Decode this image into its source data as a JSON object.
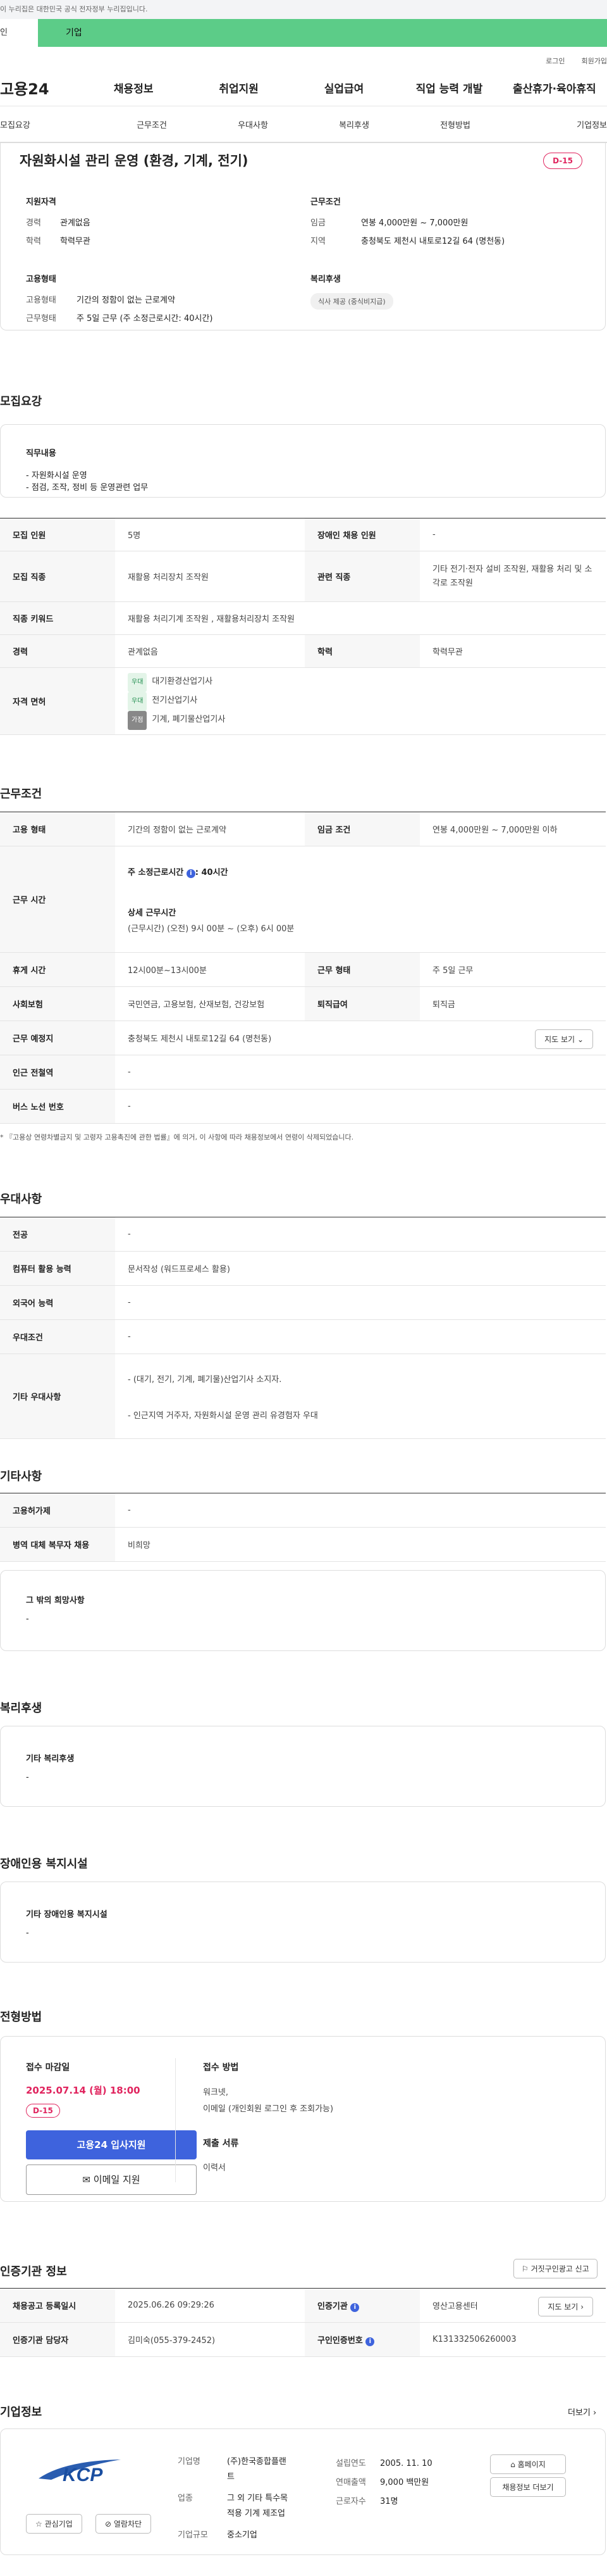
{
  "topbar": {
    "gov_notice": "이 누리집은 대한민국 공식 전자정부 누리집입니다."
  },
  "tabs": {
    "tab1": "인",
    "tab2": "기업"
  },
  "util": {
    "login": "로그인",
    "join": "회원가입"
  },
  "gnb": {
    "logo": "고용24",
    "menu": [
      "채용정보",
      "취업지원",
      "실업급여",
      "직업 능력 개발",
      "출산휴가·육아휴직"
    ]
  },
  "subnav": [
    "모집요강",
    "근무조건",
    "우대사항",
    "복리후생",
    "전형방법",
    "기업정보"
  ],
  "job": {
    "title": "자원화시설 관리 운영 (환경, 기계, 전기)",
    "dday": "D-15",
    "qual_title": "지원자격",
    "career_k": "경력",
    "career_v": "관계없음",
    "edu_k": "학력",
    "edu_v": "학력무관",
    "cond_title": "근무조건",
    "wage_k": "임금",
    "wage_v": "연봉 4,000만원 ~ 7,000만원",
    "loc_k": "지역",
    "loc_v": "충청북도 제천시 내토로12길 64 (명천동)",
    "emp_title": "고용형태",
    "emptype_k": "고용형태",
    "emptype_v": "기간의 정함이 없는 근로계약",
    "worktype_k": "근무형태",
    "worktype_v": "주 5일 근무 (주 소정근로시간: 40시간)",
    "welfare_title": "복리후생",
    "welfare_chip": "식사 제공 (중식비지급)"
  },
  "recruit": {
    "title": "모집요강",
    "duty_title": "직무내용",
    "duty_lines": [
      "- 자원화시설 운영",
      "- 점검, 조작, 정비 등 운영관련 업무"
    ],
    "rows": {
      "count_k": "모집 인원",
      "count_v": "5명",
      "disabled_k": "장애인 채용 인원",
      "disabled_v": "-",
      "job_k": "모집 직종",
      "job_v": "재활용 처리장치 조작원",
      "rel_k": "관련 직종",
      "rel_v": "기타 전기·전자 설비 조작원, 재활용 처리 및 소각로 조작원",
      "kw_k": "직종 키워드",
      "kw_v": "재활용 처리기계 조작원 , 재활용처리장치 조작원",
      "career_k": "경력",
      "career_v": "관계없음",
      "edu_k": "학력",
      "edu_v": "학력무관",
      "lic_k": "자격 면허",
      "lic": [
        {
          "tag": "우대",
          "name": "대기환경산업기사"
        },
        {
          "tag": "우대",
          "name": "전기산업기사"
        },
        {
          "tag": "가점",
          "name": "기계, 폐기물산업기사"
        }
      ]
    }
  },
  "work": {
    "title": "근무조건",
    "emp_k": "고용 형태",
    "emp_v": "기간의 정함이 없는 근로계약",
    "wage_k": "임금 조건",
    "wage_v": "연봉 4,000만원 ~ 7,000만원 이하",
    "time_k": "근무 시간",
    "time_week": "주 소정근로시간",
    "time_week_v": ": 40시간",
    "time_detail_t": "상세 근무시간",
    "time_detail_v": "(근무시간) (오전) 9시 00분 ~ (오후) 6시 00분",
    "rest_k": "휴게 시간",
    "rest_v": "12시00분~13시00분",
    "form_k": "근무 형태",
    "form_v": "주 5일 근무",
    "ins_k": "사회보험",
    "ins_v": "국민연금, 고용보험, 산재보험, 건강보험",
    "sev_k": "퇴직급여",
    "sev_v": "퇴직금",
    "place_k": "근무 예정지",
    "place_v": "충청북도 제천시 내토로12길 64 (명천동)",
    "map_btn": "지도 보기",
    "subway_k": "인근 전철역",
    "subway_v": "-",
    "bus_k": "버스 노선 번호",
    "bus_v": "-",
    "note": "『고용상 연령차별금지 및 고령자 고용촉진에 관한 법률』에 의거, 이 사항에 따라 채용정보에서 연령이 삭제되었습니다."
  },
  "pref": {
    "title": "우대사항",
    "major_k": "전공",
    "major_v": "-",
    "pc_k": "컴퓨터 활용 능력",
    "pc_v": "문서작성 (워드프로세스 활용)",
    "lang_k": "외국어 능력",
    "lang_v": "-",
    "cond_k": "우대조건",
    "cond_v": "-",
    "etc_k": "기타 우대사항",
    "etc_v1": "- (대기, 전기, 기계, 폐기물)산업기사 소지자.",
    "etc_v2": "- 인근지역 거주자, 자원화시설 운영 관리 유경험자 우대"
  },
  "other": {
    "title": "기타사항",
    "emp_k": "고용허가제",
    "emp_v": "-",
    "mil_k": "병역 대체 복무자 채용",
    "mil_v": "비희망",
    "wish_t": "그 밖의 희망사항",
    "wish_v": "-"
  },
  "welfare": {
    "title": "복리후생",
    "box_t": "기타 복리후생",
    "box_v": "-"
  },
  "disab": {
    "title": "장애인용 복지시설",
    "box_t": "기타 장애인용 복지시설",
    "box_v": "-"
  },
  "select": {
    "title": "전형방법",
    "deadline_t": "접수 마감일",
    "deadline_v": "2025.07.14 (월) 18:00",
    "dday": "D-15",
    "apply_btn": "고용24 입사지원",
    "email_btn": "이메일 지원",
    "method_t": "접수 방법",
    "method_v1": "워크넷,",
    "method_v2": "이메일 (개인회원 로그인 후 조회가능)",
    "doc_t": "제출 서류",
    "doc_v": "이력서"
  },
  "cert": {
    "title": "인증기관 정보",
    "report_btn": "거짓구인광고 신고",
    "reg_k": "채용공고 등록일시",
    "reg_v": "2025.06.26 09:29:26",
    "org_k": "인증기관",
    "org_v": "영산고용센터",
    "map_btn": "지도 보기",
    "mgr_k": "인증기관 담당자",
    "mgr_v": "김미숙(055-379-2452)",
    "no_k": "구인인증번호",
    "no_v": "K131332506260003"
  },
  "company": {
    "title": "기업정보",
    "more": "더보기",
    "logo_text": "KCP",
    "fav_btn": "관심기업",
    "block_btn": "열람차단",
    "name_k": "기업명",
    "name_v1": "(주)한국종합플랜",
    "name_v2": "트",
    "ind_k": "업종",
    "ind_v1": "그 외 기타 특수목",
    "ind_v2": "적용 기계 제조업",
    "size_k": "기업규모",
    "size_v": "중소기업",
    "year_k": "설립연도",
    "year_v": "2005. 11. 10",
    "sales_k": "연매출액",
    "sales_v": "9,000 백만원",
    "emp_k": "근로자수",
    "emp_v": "31명",
    "home_btn": "홈페이지",
    "list_btn": "채용정보 더보기"
  }
}
